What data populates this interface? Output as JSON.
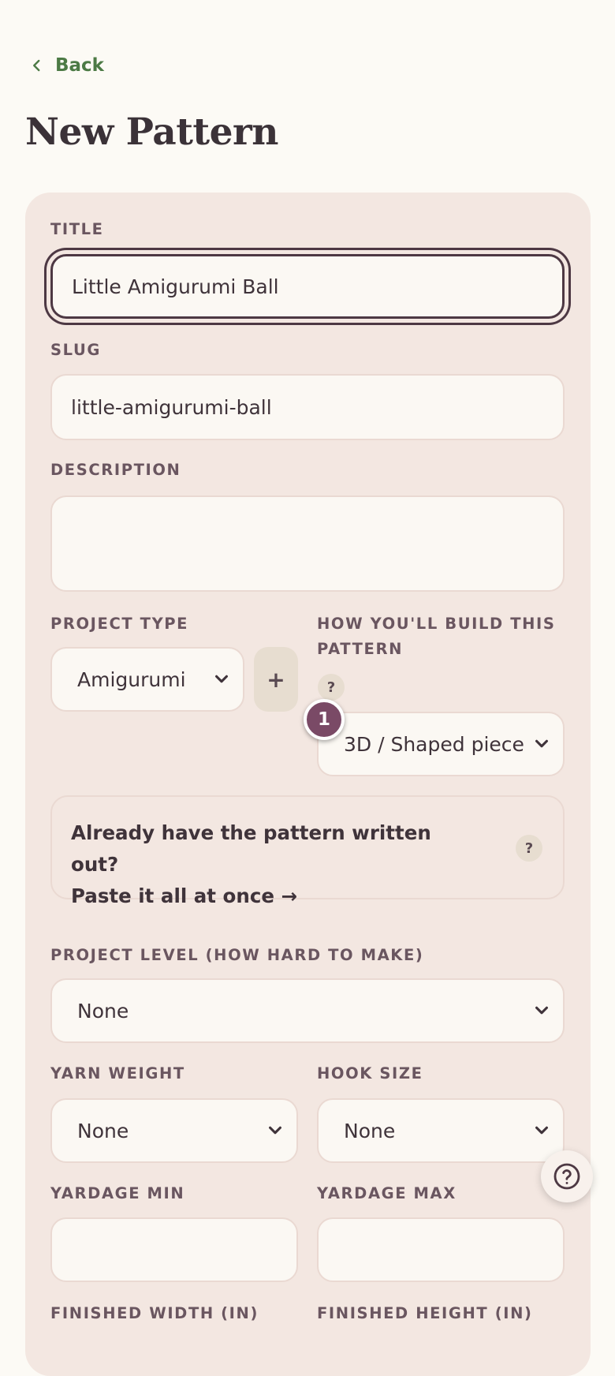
{
  "nav": {
    "back_label": "Back"
  },
  "page": {
    "title": "New Pattern"
  },
  "form": {
    "title": {
      "label": "TITLE",
      "value": "Little Amigurumi Ball"
    },
    "slug": {
      "label": "SLUG",
      "value": "little-amigurumi-ball"
    },
    "description": {
      "label": "DESCRIPTION",
      "value": ""
    },
    "project_type": {
      "label": "PROJECT TYPE",
      "value": "Amigurumi",
      "add_label": "+"
    },
    "build_method": {
      "label_line1": "HOW YOU'LL BUILD THIS",
      "label_line2": "PATTERN",
      "help": "?",
      "value": "3D / Shaped piece"
    },
    "step_badge": "1",
    "paste": {
      "line1": "Already have the pattern written out?",
      "line2": "Paste it all at once →",
      "help": "?"
    },
    "project_level": {
      "label": "PROJECT LEVEL (HOW HARD TO MAKE)",
      "value": "None"
    },
    "yarn_weight": {
      "label": "YARN WEIGHT",
      "value": "None"
    },
    "hook_size": {
      "label": "HOOK SIZE",
      "value": "None"
    },
    "yardage_min": {
      "label": "YARDAGE MIN",
      "value": ""
    },
    "yardage_max": {
      "label": "YARDAGE MAX",
      "value": ""
    },
    "finished_width": {
      "label": "FINISHED WIDTH (IN)"
    },
    "finished_height": {
      "label": "FINISHED HEIGHT (IN)"
    }
  },
  "icons": {
    "back": "chevron-left-icon",
    "dropdown": "chevron-down-icon",
    "help_fab": "question-circle-icon"
  },
  "colors": {
    "accent_green": "#4c7a45",
    "card_bg": "#f3e7e1",
    "page_bg": "#fcfaf5",
    "badge": "#7a4a66"
  }
}
